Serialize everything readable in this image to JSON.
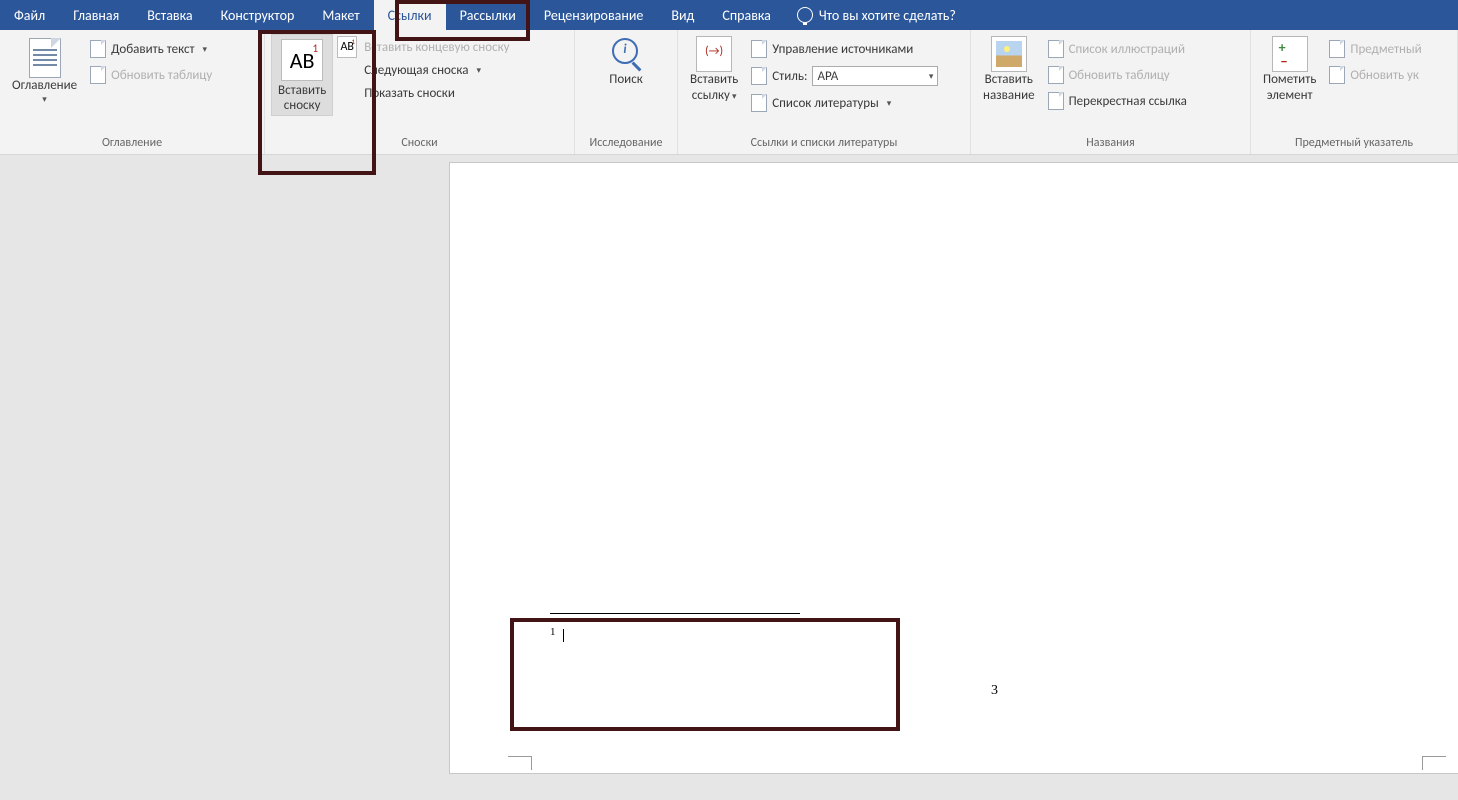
{
  "tabs": {
    "file": "Файл",
    "home": "Главная",
    "insert": "Вставка",
    "design": "Конструктор",
    "layout": "Макет",
    "references": "Ссылки",
    "mailings": "Рассылки",
    "review": "Рецензирование",
    "view": "Вид",
    "help": "Справка",
    "tellme": "Что вы хотите сделать?"
  },
  "groups": {
    "toc": {
      "title": "Оглавление",
      "button": "Оглавление",
      "add_text": "Добавить текст",
      "update": "Обновить таблицу"
    },
    "footnotes": {
      "title": "Сноски",
      "insert_label1": "Вставить",
      "insert_label2": "сноску",
      "ab": "AB",
      "sup": "1",
      "insert_endnote": "Вставить концевую сноску",
      "next_footnote": "Следующая сноска",
      "show_notes": "Показать сноски"
    },
    "research": {
      "title": "Исследование",
      "search": "Поиск"
    },
    "citations": {
      "title": "Ссылки и списки литературы",
      "insert_citation1": "Вставить",
      "insert_citation2": "ссылку",
      "manage_sources": "Управление источниками",
      "style_label": "Стиль:",
      "style_value": "APA",
      "bibliography": "Список литературы"
    },
    "captions": {
      "title": "Названия",
      "insert_caption1": "Вставить",
      "insert_caption2": "название",
      "figures_list": "Список иллюстраций",
      "update_table": "Обновить таблицу",
      "cross_ref": "Перекрестная ссылка"
    },
    "index": {
      "title": "Предметный указатель",
      "mark_entry1": "Пометить",
      "mark_entry2": "элемент",
      "index": "Предметный",
      "update_index": "Обновить ук"
    }
  },
  "doc": {
    "footnote_num": "1",
    "page_num": "3"
  }
}
